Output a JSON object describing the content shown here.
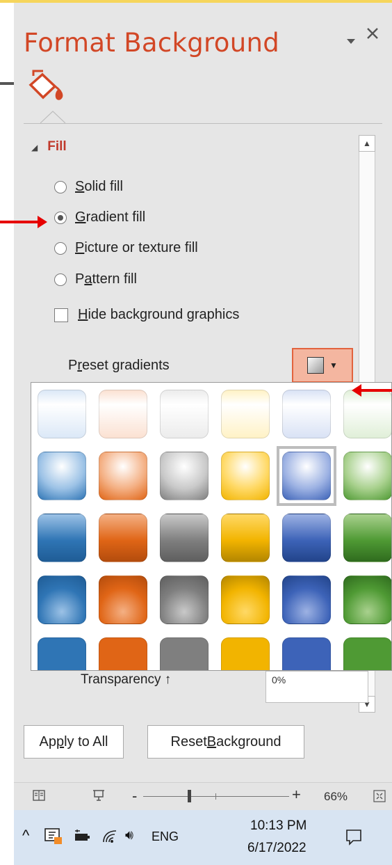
{
  "pane": {
    "title": "Format Background",
    "collapse_icon": "caret-down-icon",
    "close_icon": "close-icon",
    "tab_icon": "paint-bucket-icon"
  },
  "fill": {
    "section_label": "Fill",
    "options": [
      {
        "pre": "",
        "u": "S",
        "post": "olid fill",
        "selected": false
      },
      {
        "pre": "",
        "u": "G",
        "post": "radient fill",
        "selected": true
      },
      {
        "pre": "",
        "u": "P",
        "post": "icture or texture fill",
        "selected": false
      },
      {
        "pre": "P",
        "u": "a",
        "post": "ttern fill",
        "selected": false
      }
    ],
    "hide_graphics": {
      "pre": "",
      "u": "H",
      "post": "ide background graphics",
      "checked": false
    },
    "preset": {
      "pre": "P",
      "u": "r",
      "post": "eset gradients"
    }
  },
  "gallery": {
    "columns": [
      {
        "name": "blue",
        "light": "#dbe8f7",
        "mid": "#9cc2e6",
        "dark": "#2f75b5",
        "deep": "#1f5c95"
      },
      {
        "name": "orange",
        "light": "#fbe1d2",
        "mid": "#f4b084",
        "dark": "#e06516",
        "deep": "#b34c0d"
      },
      {
        "name": "gray",
        "light": "#ececec",
        "mid": "#c9c9c9",
        "dark": "#7f7f7f",
        "deep": "#5e5e5e"
      },
      {
        "name": "gold",
        "light": "#fff2c6",
        "mid": "#ffd966",
        "dark": "#f2b400",
        "deep": "#b38600"
      },
      {
        "name": "indigo",
        "light": "#d9e2f5",
        "mid": "#9db2e3",
        "dark": "#3d63b8",
        "deep": "#22448a"
      },
      {
        "name": "green",
        "light": "#e0efd8",
        "mid": "#a9d18e",
        "dark": "#4f9a34",
        "deep": "#2f6b1e"
      }
    ],
    "selected_row": 1,
    "selected_col": 4
  },
  "transparency": {
    "label": "Transparency",
    "value": "0%"
  },
  "buttons": {
    "apply_all": {
      "pre": "Ap",
      "u": "p",
      "post": "ly to All"
    },
    "reset": {
      "pre": "Reset ",
      "u": "B",
      "post": "ackground"
    }
  },
  "statusbar": {
    "zoom": "66%"
  },
  "taskbar": {
    "language": "ENG",
    "time": "10:13 PM",
    "date": "6/17/2022"
  }
}
